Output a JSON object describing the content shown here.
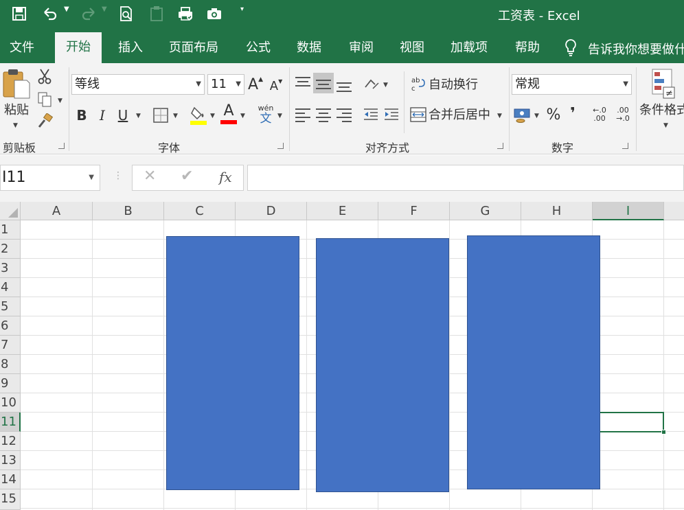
{
  "window": {
    "title": "工资表  -  Excel"
  },
  "tabs": [
    "文件",
    "开始",
    "插入",
    "页面布局",
    "公式",
    "数据",
    "审阅",
    "视图",
    "加载项",
    "帮助"
  ],
  "active_tab": "开始",
  "tell_me": "告诉我你想要做什",
  "ribbon": {
    "clipboard": {
      "paste_label": "粘贴",
      "group_label": "剪贴板"
    },
    "font": {
      "font_name": "等线",
      "font_size": "11",
      "grow_label": "A",
      "shrink_label": "A",
      "bold_label": "B",
      "italic_label": "I",
      "underline_label": "U",
      "font_color_label": "A",
      "phonetic_top": "wén",
      "phonetic_bottom": "文",
      "group_label": "字体",
      "fill_color": "#ffff00",
      "font_color": "#ff0000"
    },
    "alignment": {
      "wrap_label": "自动换行",
      "merge_label": "合并后居中",
      "group_label": "对齐方式"
    },
    "number": {
      "format": "常规",
      "percent_label": "%",
      "comma_label": "❜",
      "inc_decimal_top": "←.0",
      "inc_decimal_bottom": ".00",
      "dec_decimal_top": ".00",
      "dec_decimal_bottom": "→.0",
      "group_label": "数字"
    },
    "styles": {
      "conditional_label": "条件格式"
    }
  },
  "formula_bar": {
    "name_box": "I11",
    "fx_label": "fx",
    "value": ""
  },
  "sheet": {
    "columns": [
      "A",
      "B",
      "C",
      "D",
      "E",
      "F",
      "G",
      "H",
      "I"
    ],
    "rows": [
      "1",
      "2",
      "3",
      "4",
      "5",
      "6",
      "7",
      "8",
      "9",
      "10",
      "11",
      "12",
      "13",
      "14",
      "15"
    ],
    "selected_cell": "I11",
    "selected_column": "I",
    "selected_row": "11",
    "shape_count": 3,
    "shape_fill": "#4472c4",
    "accent": "#217346"
  }
}
